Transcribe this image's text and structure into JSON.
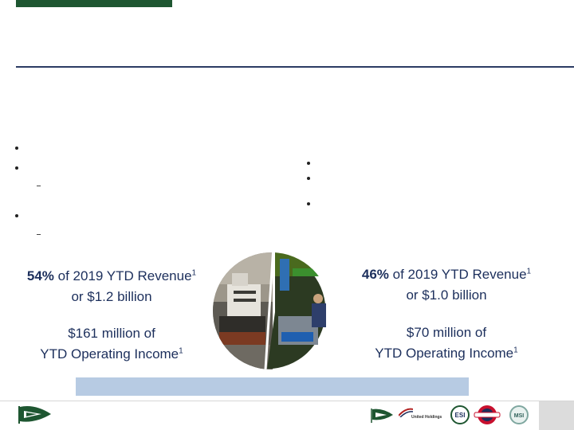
{
  "left_stat": {
    "pct": "54%",
    "revenue_text": " of 2019 YTD Revenue",
    "sup": "1",
    "amount": "or $1.2 billion",
    "income_line1": "$161 million of",
    "income_line2": "YTD Operating Income"
  },
  "right_stat": {
    "pct": "46%",
    "revenue_text": " of 2019 YTD Revenue",
    "sup": "1",
    "amount": "or $1.0 billion",
    "income_line1": "$70 million of",
    "income_line2": "YTD Operating Income"
  },
  "footer_logos": {
    "united_holdings": "United Holdings",
    "esi": "ESI",
    "msi": "MSI"
  },
  "colors": {
    "brand_green": "#1e5631",
    "navy": "#1c2f5c",
    "banner": "#b7cbe3"
  },
  "icons": [
    "kirby-flag-logo",
    "united-holdings-logo",
    "esi-logo",
    "stewart-stevenson-logo",
    "msi-logo"
  ]
}
